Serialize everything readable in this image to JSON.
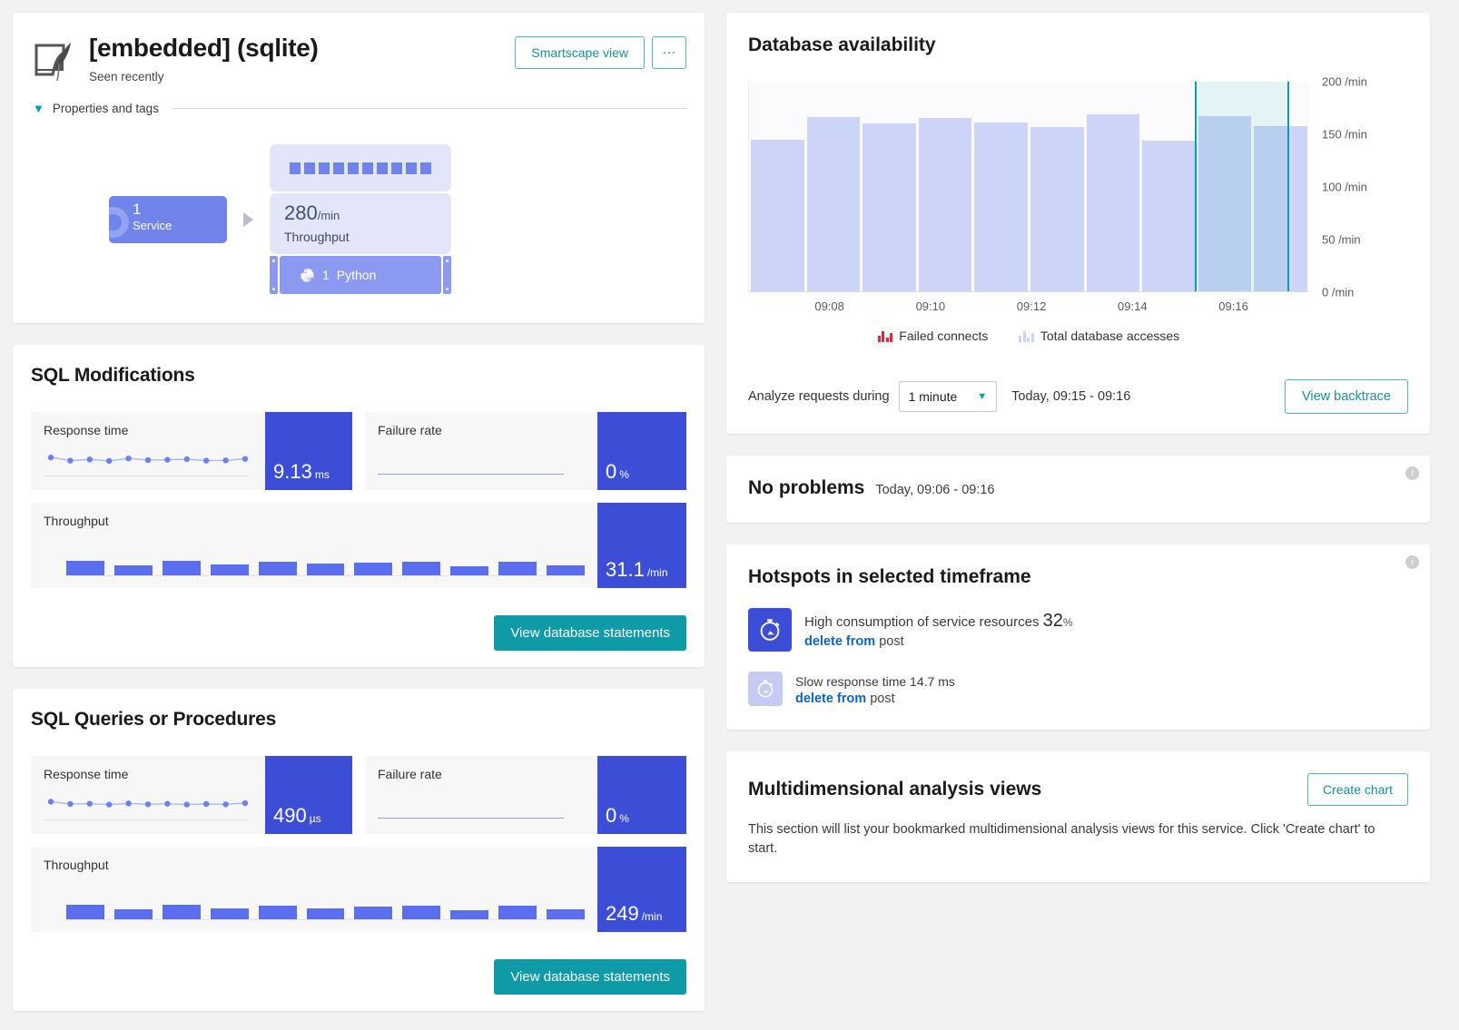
{
  "header": {
    "title": "[embedded] (sqlite)",
    "subtitle": "Seen recently",
    "smartscape_label": "Smartscape view",
    "more_label": "···",
    "properties_label": "Properties and tags",
    "db_icon": "sqlite-feather-icon"
  },
  "topology": {
    "service_count": "1",
    "service_label": "Service",
    "throughput_value": "280",
    "throughput_unit": "/min",
    "throughput_label": "Throughput",
    "process_count": "1",
    "process_label": "Python",
    "process_icon": "python-icon",
    "sparkline_squares": [
      1,
      1,
      1,
      1,
      1,
      1,
      1,
      1,
      1,
      1
    ]
  },
  "sql_modifications": {
    "title": "SQL Modifications",
    "response_time": {
      "label": "Response time",
      "value": "9.13",
      "unit": "ms",
      "points": [
        0.62,
        0.4,
        0.48,
        0.38,
        0.55,
        0.44,
        0.46,
        0.5,
        0.4,
        0.42,
        0.52
      ]
    },
    "failure_rate": {
      "label": "Failure rate",
      "value": "0",
      "unit": "%"
    },
    "throughput": {
      "label": "Throughput",
      "value": "31.1",
      "unit": "/min",
      "bars": [
        0.62,
        0.42,
        0.6,
        0.46,
        0.58,
        0.5,
        0.52,
        0.58,
        0.4,
        0.58,
        0.44
      ]
    },
    "footer_button": "View database statements"
  },
  "sql_queries": {
    "title": "SQL Queries or Procedures",
    "response_time": {
      "label": "Response time",
      "value": "490",
      "unit": "µs",
      "points": [
        0.6,
        0.44,
        0.46,
        0.4,
        0.48,
        0.42,
        0.46,
        0.4,
        0.44,
        0.42,
        0.5
      ]
    },
    "failure_rate": {
      "label": "Failure rate",
      "value": "0",
      "unit": "%"
    },
    "throughput": {
      "label": "Throughput",
      "value": "249",
      "unit": "/min",
      "bars": [
        0.62,
        0.44,
        0.6,
        0.46,
        0.58,
        0.48,
        0.52,
        0.56,
        0.4,
        0.58,
        0.44
      ]
    },
    "footer_button": "View database statements"
  },
  "availability": {
    "title": "Database availability",
    "legend": [
      {
        "label": "Failed connects",
        "color": "#e02a3c",
        "icon": "bar-chart-icon"
      },
      {
        "label": "Total database accesses",
        "color": "#ccd4f7",
        "icon": "bar-chart-icon"
      }
    ],
    "analyze_label": "Analyze requests during",
    "interval_value": "1 minute",
    "range_label": "Today, 09:15 - 09:16",
    "backtrace_button": "View backtrace",
    "selection_start_pct": 79.5,
    "selection_end_pct": 96.5
  },
  "chart_data": {
    "type": "bar",
    "title": "Database availability",
    "xlabel": "",
    "ylabel": "/min",
    "ylim": [
      0,
      200
    ],
    "yticks": [
      0,
      50,
      100,
      150,
      200
    ],
    "ytick_labels": [
      "0 /min",
      "50 /min",
      "100 /min",
      "150 /min",
      "200 /min"
    ],
    "xtick_labels": [
      "09:08",
      "09:10",
      "09:12",
      "09:14",
      "09:16"
    ],
    "xtick_positions_pct": [
      14.5,
      32.5,
      50.5,
      68.5,
      86.5
    ],
    "grid": false,
    "legend_position": "bottom",
    "series": [
      {
        "name": "Total database accesses",
        "color": "#ccd4f7",
        "values": [
          145,
          166,
          160,
          165,
          161,
          157,
          169,
          144,
          167,
          158
        ]
      },
      {
        "name": "Failed connects",
        "color": "#e02a3c",
        "values": [
          0,
          0,
          0,
          0,
          0,
          0,
          0,
          0,
          0,
          0
        ]
      }
    ]
  },
  "problems": {
    "title": "No problems",
    "range": "Today, 09:06 - 09:16",
    "info_icon": "info-icon"
  },
  "hotspots": {
    "title": "Hotspots in selected timeframe",
    "info_icon": "info-icon",
    "items": [
      {
        "icon": "stopwatch-icon",
        "text": "High consumption of service resources",
        "value": "32",
        "unit": "%",
        "link": "delete from",
        "suffix": "post"
      },
      {
        "icon": "stopwatch-icon",
        "text": "Slow response time 14.7 ms",
        "value": "",
        "unit": "",
        "link": "delete from",
        "suffix": "post"
      }
    ]
  },
  "multidimensional": {
    "title": "Multidimensional analysis views",
    "create_button": "Create chart",
    "description": "This section will list your bookmarked multidimensional analysis views for this service. Click 'Create chart' to start."
  }
}
